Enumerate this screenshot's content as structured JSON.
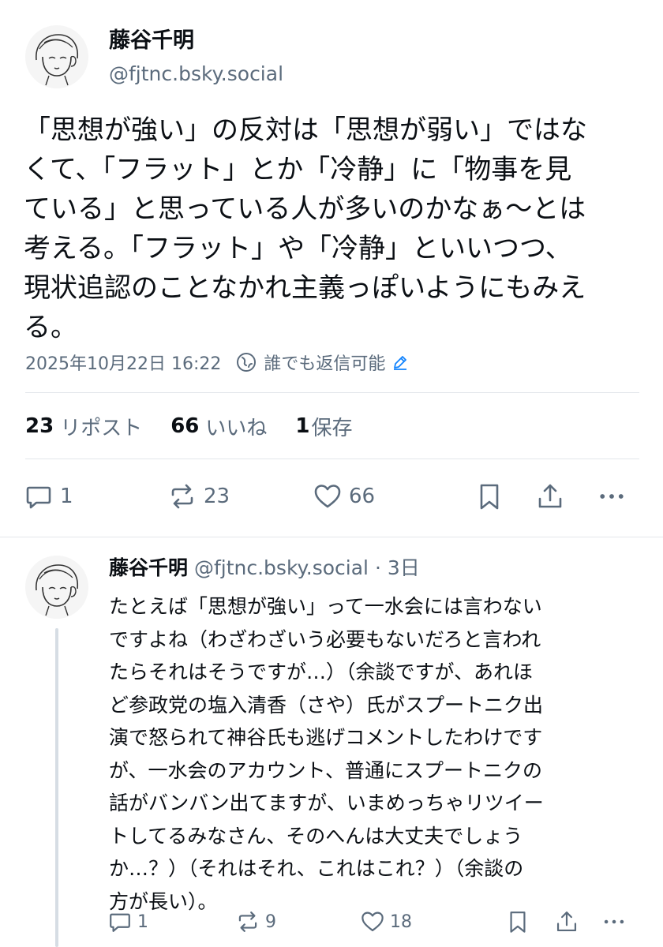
{
  "post": {
    "author": {
      "display_name": "藤谷千明",
      "handle": "@fjtnc.bsky.social",
      "avatar_icon": "sketch-portrait-avatar"
    },
    "text_lines": [
      "「思想が強い」の反対は「思想が弱い」ではな",
      "くて、「フラット」とか「冷静」に「物事を見",
      "ている」と思っている人が多いのかなぁ〜とは",
      "考える。「フラット」や「冷静」といいつつ、",
      "現状追認のことなかれ主義っぽいようにもみえ",
      "る。"
    ],
    "timestamp": "2025年10月22日 16:22",
    "reply_setting": "誰でも返信可能",
    "stats": {
      "reposts_count": "23",
      "reposts_label": "リポスト",
      "likes_count": "66",
      "likes_label": "いいね",
      "saves_count": "1",
      "saves_label": "保存"
    },
    "actions": {
      "reply_count": "1",
      "repost_count": "23",
      "like_count": "66"
    }
  },
  "reply": {
    "author": {
      "display_name": "藤谷千明",
      "handle": "@fjtnc.bsky.social",
      "age": "· 3日",
      "avatar_icon": "sketch-portrait-avatar"
    },
    "text_lines": [
      "たとえば「思想が強い」って一水会には言わない",
      "ですよね（わざわざいう必要もないだろと言われ",
      "たらそれはそうですが…）（余談ですが、あれほ",
      "ど参政党の塩入清香（さや）氏がスプートニク出",
      "演で怒られて神谷氏も逃げコメントしたわけです",
      "が、一水会のアカウント、普通にスプートニクの",
      "話がバンバン出てますが、いまめっちゃリツイー",
      "トしてるみなさん、そのへんは大丈夫でしょう",
      "か…？）（それはそれ、これはこれ？）（余談の",
      "方が長い）。"
    ],
    "actions": {
      "reply_count": "1",
      "repost_count": "9",
      "like_count": "18"
    }
  },
  "colors": {
    "text_primary": "#0b0f14",
    "text_secondary": "#5b6b7c",
    "link_accent": "#1083fe",
    "divider": "#e3e7eb",
    "thread_line": "#d6dde4"
  }
}
